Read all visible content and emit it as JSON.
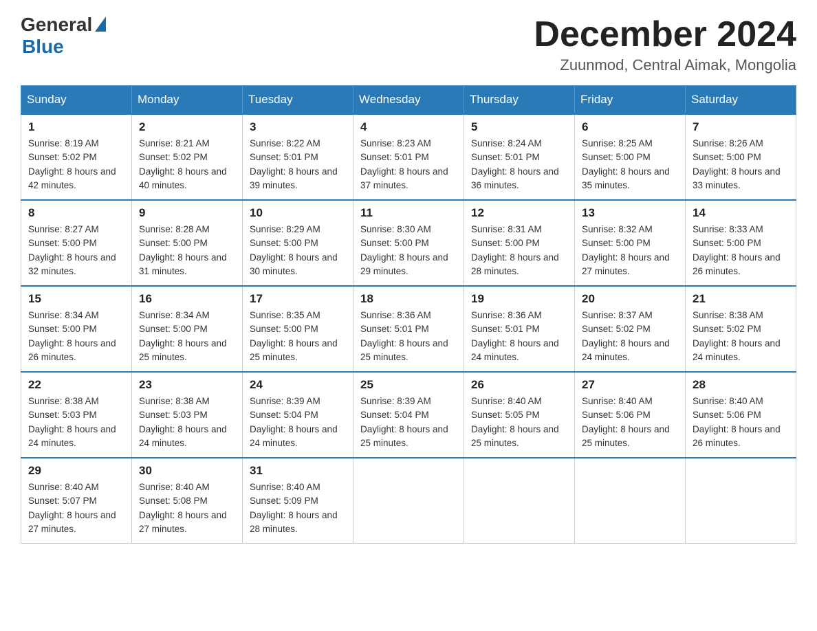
{
  "logo": {
    "general": "General",
    "blue": "Blue"
  },
  "title": "December 2024",
  "location": "Zuunmod, Central Aimak, Mongolia",
  "days_of_week": [
    "Sunday",
    "Monday",
    "Tuesday",
    "Wednesday",
    "Thursday",
    "Friday",
    "Saturday"
  ],
  "weeks": [
    [
      {
        "day": "1",
        "sunrise": "8:19 AM",
        "sunset": "5:02 PM",
        "daylight": "8 hours and 42 minutes."
      },
      {
        "day": "2",
        "sunrise": "8:21 AM",
        "sunset": "5:02 PM",
        "daylight": "8 hours and 40 minutes."
      },
      {
        "day": "3",
        "sunrise": "8:22 AM",
        "sunset": "5:01 PM",
        "daylight": "8 hours and 39 minutes."
      },
      {
        "day": "4",
        "sunrise": "8:23 AM",
        "sunset": "5:01 PM",
        "daylight": "8 hours and 37 minutes."
      },
      {
        "day": "5",
        "sunrise": "8:24 AM",
        "sunset": "5:01 PM",
        "daylight": "8 hours and 36 minutes."
      },
      {
        "day": "6",
        "sunrise": "8:25 AM",
        "sunset": "5:00 PM",
        "daylight": "8 hours and 35 minutes."
      },
      {
        "day": "7",
        "sunrise": "8:26 AM",
        "sunset": "5:00 PM",
        "daylight": "8 hours and 33 minutes."
      }
    ],
    [
      {
        "day": "8",
        "sunrise": "8:27 AM",
        "sunset": "5:00 PM",
        "daylight": "8 hours and 32 minutes."
      },
      {
        "day": "9",
        "sunrise": "8:28 AM",
        "sunset": "5:00 PM",
        "daylight": "8 hours and 31 minutes."
      },
      {
        "day": "10",
        "sunrise": "8:29 AM",
        "sunset": "5:00 PM",
        "daylight": "8 hours and 30 minutes."
      },
      {
        "day": "11",
        "sunrise": "8:30 AM",
        "sunset": "5:00 PM",
        "daylight": "8 hours and 29 minutes."
      },
      {
        "day": "12",
        "sunrise": "8:31 AM",
        "sunset": "5:00 PM",
        "daylight": "8 hours and 28 minutes."
      },
      {
        "day": "13",
        "sunrise": "8:32 AM",
        "sunset": "5:00 PM",
        "daylight": "8 hours and 27 minutes."
      },
      {
        "day": "14",
        "sunrise": "8:33 AM",
        "sunset": "5:00 PM",
        "daylight": "8 hours and 26 minutes."
      }
    ],
    [
      {
        "day": "15",
        "sunrise": "8:34 AM",
        "sunset": "5:00 PM",
        "daylight": "8 hours and 26 minutes."
      },
      {
        "day": "16",
        "sunrise": "8:34 AM",
        "sunset": "5:00 PM",
        "daylight": "8 hours and 25 minutes."
      },
      {
        "day": "17",
        "sunrise": "8:35 AM",
        "sunset": "5:00 PM",
        "daylight": "8 hours and 25 minutes."
      },
      {
        "day": "18",
        "sunrise": "8:36 AM",
        "sunset": "5:01 PM",
        "daylight": "8 hours and 25 minutes."
      },
      {
        "day": "19",
        "sunrise": "8:36 AM",
        "sunset": "5:01 PM",
        "daylight": "8 hours and 24 minutes."
      },
      {
        "day": "20",
        "sunrise": "8:37 AM",
        "sunset": "5:02 PM",
        "daylight": "8 hours and 24 minutes."
      },
      {
        "day": "21",
        "sunrise": "8:38 AM",
        "sunset": "5:02 PM",
        "daylight": "8 hours and 24 minutes."
      }
    ],
    [
      {
        "day": "22",
        "sunrise": "8:38 AM",
        "sunset": "5:03 PM",
        "daylight": "8 hours and 24 minutes."
      },
      {
        "day": "23",
        "sunrise": "8:38 AM",
        "sunset": "5:03 PM",
        "daylight": "8 hours and 24 minutes."
      },
      {
        "day": "24",
        "sunrise": "8:39 AM",
        "sunset": "5:04 PM",
        "daylight": "8 hours and 24 minutes."
      },
      {
        "day": "25",
        "sunrise": "8:39 AM",
        "sunset": "5:04 PM",
        "daylight": "8 hours and 25 minutes."
      },
      {
        "day": "26",
        "sunrise": "8:40 AM",
        "sunset": "5:05 PM",
        "daylight": "8 hours and 25 minutes."
      },
      {
        "day": "27",
        "sunrise": "8:40 AM",
        "sunset": "5:06 PM",
        "daylight": "8 hours and 25 minutes."
      },
      {
        "day": "28",
        "sunrise": "8:40 AM",
        "sunset": "5:06 PM",
        "daylight": "8 hours and 26 minutes."
      }
    ],
    [
      {
        "day": "29",
        "sunrise": "8:40 AM",
        "sunset": "5:07 PM",
        "daylight": "8 hours and 27 minutes."
      },
      {
        "day": "30",
        "sunrise": "8:40 AM",
        "sunset": "5:08 PM",
        "daylight": "8 hours and 27 minutes."
      },
      {
        "day": "31",
        "sunrise": "8:40 AM",
        "sunset": "5:09 PM",
        "daylight": "8 hours and 28 minutes."
      },
      null,
      null,
      null,
      null
    ]
  ]
}
